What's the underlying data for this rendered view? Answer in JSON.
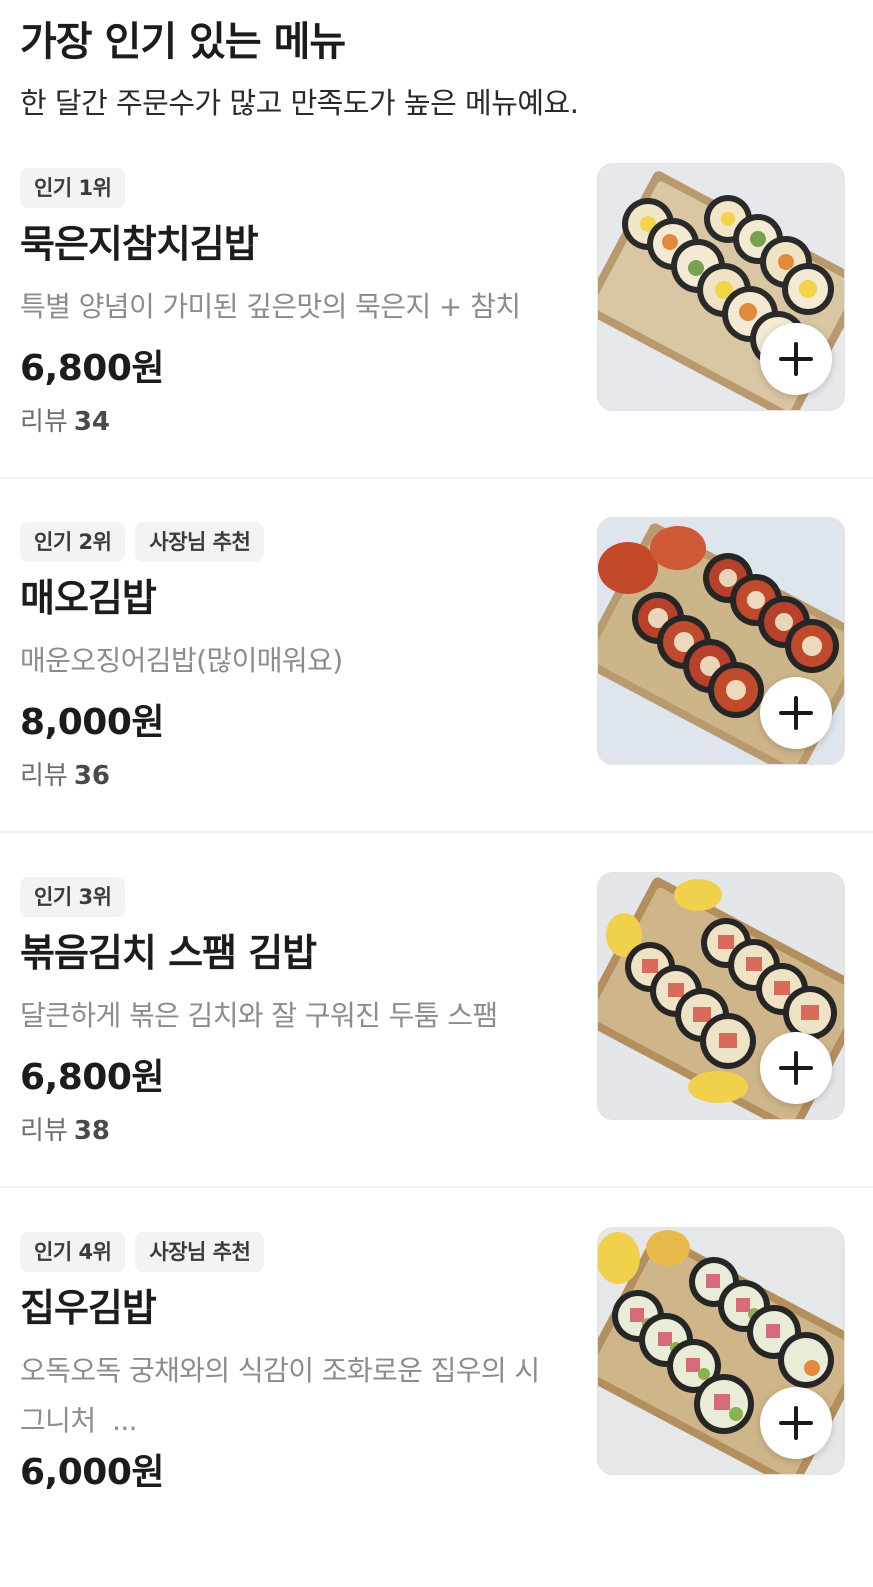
{
  "section": {
    "title": "가장 인기 있는 메뉴",
    "subtitle": "한 달간 주문수가 많고 만족도가 높은 메뉴예요."
  },
  "review_label": "리뷰",
  "items": [
    {
      "badges": [
        "인기 1위"
      ],
      "name": "묵은지참치김밥",
      "description": "특별 양념이 가미된 깊은맛의 묵은지 + 참치",
      "price": "6,800원",
      "reviews": "34",
      "image": "tuna-kimbap-photo"
    },
    {
      "badges": [
        "인기 2위",
        "사장님 추천"
      ],
      "name": "매오김밥",
      "description": "매운오징어김밥(많이매워요)",
      "price": "8,000원",
      "reviews": "36",
      "image": "spicy-squid-kimbap-photo"
    },
    {
      "badges": [
        "인기 3위"
      ],
      "name": "볶음김치 스팸 김밥",
      "description": "달큰하게 볶은 김치와 잘 구워진 두툼 스팸",
      "price": "6,800원",
      "reviews": "38",
      "image": "kimchi-spam-kimbap-photo"
    },
    {
      "badges": [
        "인기 4위",
        "사장님 추천"
      ],
      "name": "집우김밥",
      "description_line1": "오독오독 궁채와의 식감이 조화로운 집우의 시",
      "description_line2": "그니처  ...",
      "price": "6,000원",
      "image": "jibwoo-kimbap-photo"
    }
  ],
  "colors": {
    "badge_bg": "#f2f3f5",
    "description": "#8c8c8c",
    "divider": "#f1f1f1"
  }
}
